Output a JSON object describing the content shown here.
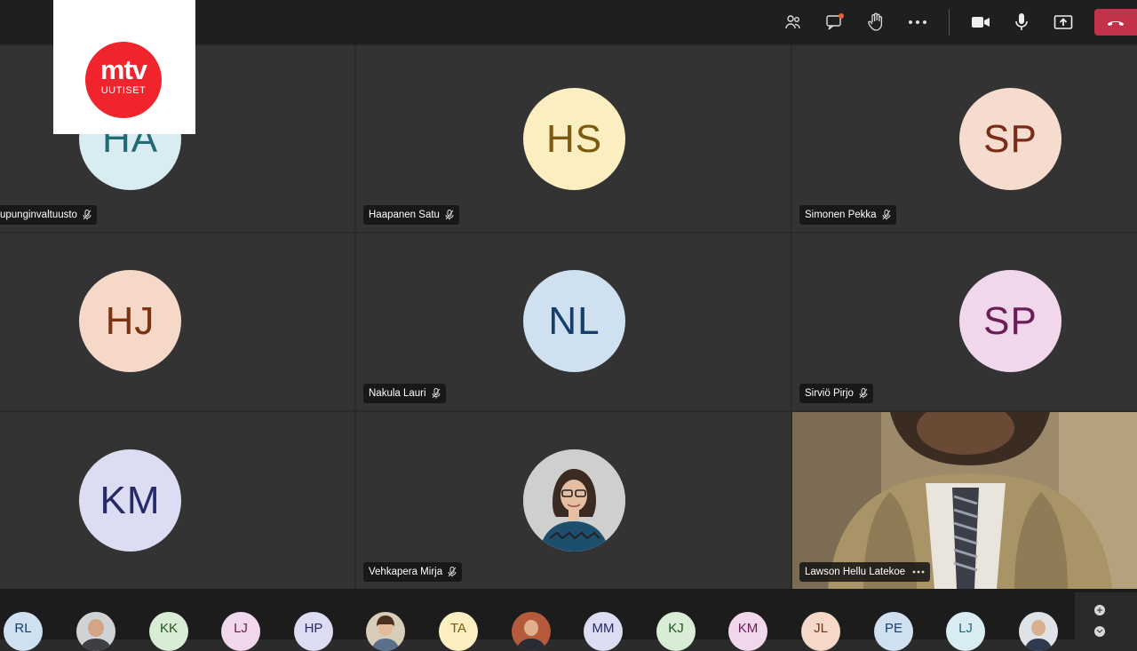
{
  "logo": {
    "main": "mtv",
    "sub": "UUTISET"
  },
  "toolbar": {
    "icons": [
      "people-icon",
      "chat-icon",
      "raise-hand-icon",
      "more-icon",
      "camera-icon",
      "mic-icon",
      "share-icon",
      "leave-icon"
    ],
    "chat_badge_color": "#e8613b",
    "leave_color": "#c4314b"
  },
  "tiles": [
    {
      "initials": "HA",
      "name": "upunginvaltuusto",
      "avatar_bg": "#d9ecf2",
      "avatar_fg": "#236b74"
    },
    {
      "initials": "HS",
      "name": "Haapanen Satu",
      "avatar_bg": "#fbeec0",
      "avatar_fg": "#7c5a13"
    },
    {
      "initials": "SP",
      "name": "Simonen Pekka",
      "avatar_bg": "#f6dbcf",
      "avatar_fg": "#7a2c18"
    },
    {
      "initials": "HJ",
      "name": "",
      "avatar_bg": "#f5d8c7",
      "avatar_fg": "#7b3310"
    },
    {
      "initials": "NL",
      "name": "Nakula Lauri",
      "avatar_bg": "#cfe0f0",
      "avatar_fg": "#173e6b"
    },
    {
      "initials": "SP",
      "name": "Sirviö Pirjo",
      "avatar_bg": "#f1d7ec",
      "avatar_fg": "#6a1e55"
    },
    {
      "initials": "KM",
      "name": "",
      "avatar_bg": "#dcdcf2",
      "avatar_fg": "#262a68"
    },
    {
      "initials": "",
      "name": "Vehkapera Mirja",
      "avatar_bg": "#c7c7c7",
      "avatar_fg": "#333333"
    },
    {
      "initials": "",
      "name": "Lawson Hellu Latekoe",
      "avatar_bg": "",
      "avatar_fg": ""
    }
  ],
  "strip": [
    {
      "initials": "RL",
      "bg": "#cfe0f0",
      "fg": "#173e6b"
    },
    {
      "initials": "",
      "bg": "#8a6a55",
      "fg": "#ffffff"
    },
    {
      "initials": "KK",
      "bg": "#d8ecd6",
      "fg": "#1f5320"
    },
    {
      "initials": "LJ",
      "bg": "#f1d7ec",
      "fg": "#6a1e55"
    },
    {
      "initials": "HP",
      "bg": "#dcdcf2",
      "fg": "#262a68"
    },
    {
      "initials": "",
      "bg": "#c9b79a",
      "fg": "#ffffff"
    },
    {
      "initials": "TA",
      "bg": "#fbeec0",
      "fg": "#7c5a13"
    },
    {
      "initials": "",
      "bg": "#b55a3a",
      "fg": "#ffffff"
    },
    {
      "initials": "MM",
      "bg": "#dcdcf2",
      "fg": "#262a68"
    },
    {
      "initials": "KJ",
      "bg": "#d8ecd6",
      "fg": "#1f5320"
    },
    {
      "initials": "KM",
      "bg": "#f1d7ec",
      "fg": "#6a1e55"
    },
    {
      "initials": "JL",
      "bg": "#f5d8c7",
      "fg": "#7b3310"
    },
    {
      "initials": "PE",
      "bg": "#cfe0f0",
      "fg": "#173e6b"
    },
    {
      "initials": "LJ",
      "bg": "#d9ecf2",
      "fg": "#236b74"
    },
    {
      "initials": "",
      "bg": "#6d7b8c",
      "fg": "#ffffff"
    }
  ]
}
